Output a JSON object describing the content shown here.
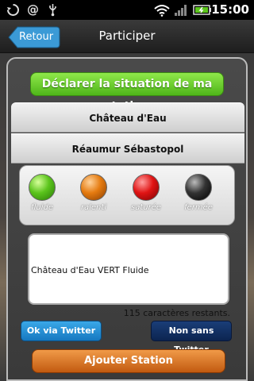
{
  "status_bar": {
    "time": "15:00",
    "icons": [
      "sync-icon",
      "at-icon",
      "usb-icon",
      "wifi-icon",
      "signal-icon",
      "battery-icon"
    ]
  },
  "header": {
    "back_label": "Retour",
    "title": "Participer"
  },
  "main": {
    "declare_label": "Déclarer la situation de ma station",
    "station_rows": [
      "Château d'Eau",
      "Réaumur Sébastopol"
    ],
    "lights": [
      {
        "label": "fluide",
        "color": "#5bc41c"
      },
      {
        "label": "ralenti",
        "color": "#e57b10"
      },
      {
        "label": "saturée",
        "color": "#e01414"
      },
      {
        "label": "fermée",
        "color": "#000000"
      }
    ],
    "message_text": "Château d'Eau VERT Fluide",
    "counter_text": "115 caractères restants.",
    "twitter_ok_label": "Ok via Twitter",
    "twitter_no_label": "Non sans Twitter",
    "add_station_label": "Ajouter Station"
  }
}
